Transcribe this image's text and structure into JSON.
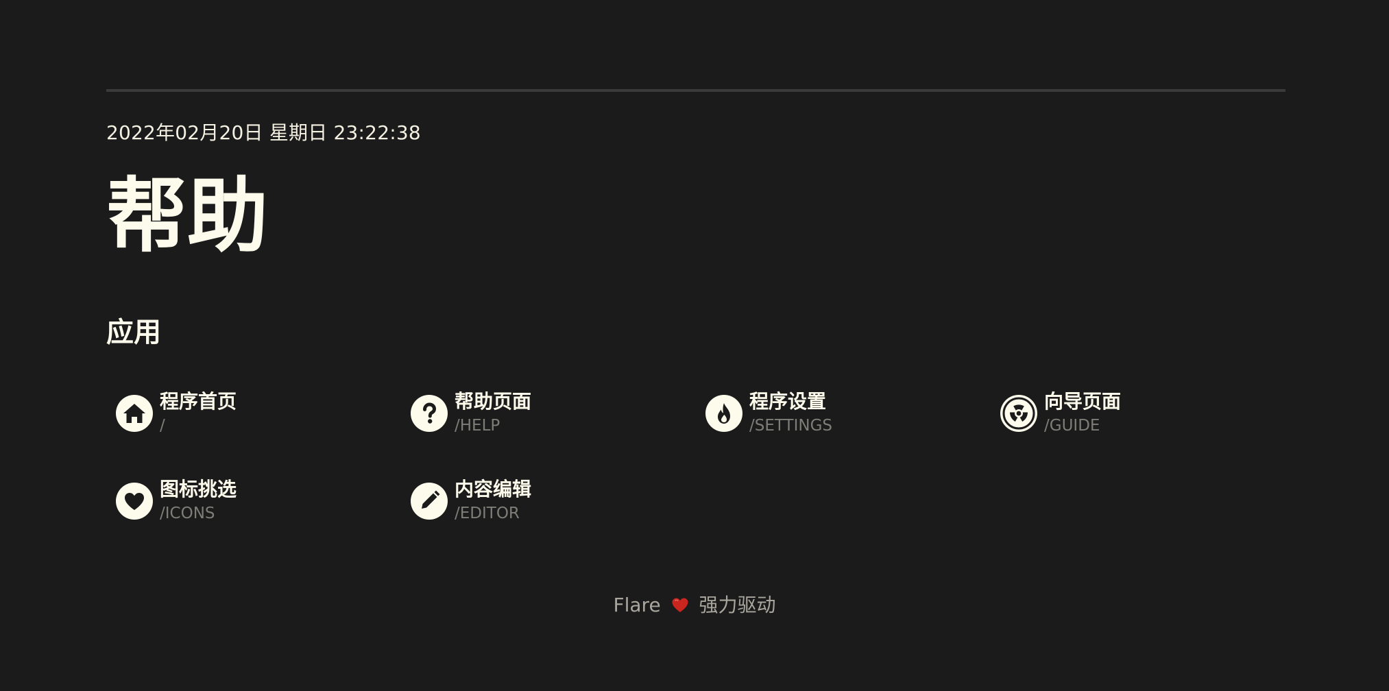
{
  "header": {
    "datetime": "2022年02月20日 星期日 23:22:38",
    "title": "帮助"
  },
  "section": {
    "title": "应用"
  },
  "apps": [
    {
      "name": "程序首页",
      "path": "/",
      "icon": "home-icon"
    },
    {
      "name": "帮助页面",
      "path": "/HELP",
      "icon": "help-circle-icon"
    },
    {
      "name": "程序设置",
      "path": "/SETTINGS",
      "icon": "fire-icon"
    },
    {
      "name": "向导页面",
      "path": "/GUIDE",
      "icon": "radioactive-icon"
    },
    {
      "name": "图标挑选",
      "path": "/ICONS",
      "icon": "heart-icon"
    },
    {
      "name": "内容编辑",
      "path": "/EDITOR",
      "icon": "pencil-icon"
    }
  ],
  "footer": {
    "before": "Flare",
    "after": "强力驱动",
    "heart_color": "#c8261e"
  },
  "colors": {
    "background": "#1b1b1b",
    "foreground": "#fdfbeb",
    "muted": "#7e7d77"
  }
}
